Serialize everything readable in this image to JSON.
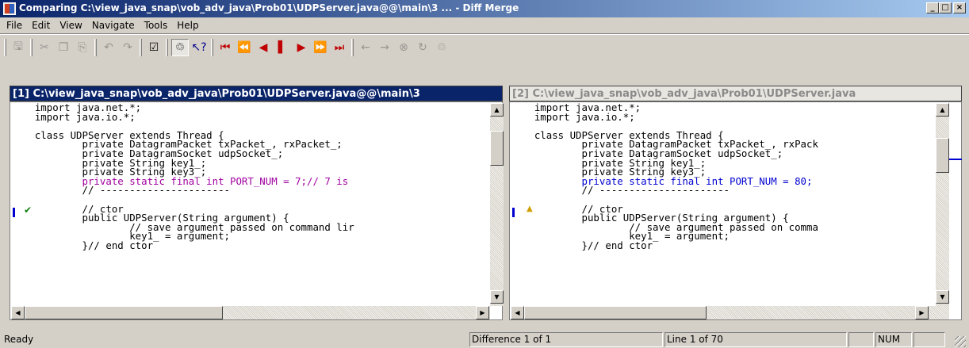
{
  "window": {
    "title": "Comparing C:\\view_java_snap\\vob_adv_java\\Prob01\\UDPServer.java@@\\main\\3 ... - Diff Merge",
    "buttons": {
      "minimize": "_",
      "maximize": "□",
      "close": "×"
    }
  },
  "menu": [
    "File",
    "Edit",
    "View",
    "Navigate",
    "Tools",
    "Help"
  ],
  "toolbar": {
    "icons": [
      "save-icon",
      "cut-icon",
      "copy-icon",
      "paste-icon",
      "undo-icon",
      "redo-icon",
      "properties-icon",
      "merge-icon",
      "help-icon",
      "first-diff-icon",
      "prev-change-icon",
      "prev-diff-icon",
      "current-diff-icon",
      "next-diff-icon",
      "next-change-icon",
      "last-diff-icon",
      "arrow-left-icon",
      "arrow-right-icon",
      "delete-icon",
      "refresh-icon",
      "merge-tool-icon"
    ]
  },
  "left_pane": {
    "header": "[1] C:\\view_java_snap\\vob_adv_java\\Prob01\\UDPServer.java@@\\main\\3",
    "lines": [
      "   import java.net.*;",
      "   import java.io.*;",
      "",
      "   class UDPServer extends Thread {",
      "           private DatagramPacket txPacket_, rxPacket_;",
      "           private DatagramSocket udpSocket_;",
      "           private String key1_;",
      "           private String key3_;",
      "           private static final int PORT_NUM = 7;// 7 is",
      "           // ----------------------",
      "",
      "           // ctor",
      "           public UDPServer(String argument) {",
      "                   // save argument passed on command lir",
      "                   key1_ = argument;",
      "           }// end ctor"
    ],
    "changed_line_index": 8,
    "marker": "✔"
  },
  "right_pane": {
    "header": "[2] C:\\view_java_snap\\vob_adv_java\\Prob01\\UDPServer.java",
    "lines": [
      "   import java.net.*;",
      "   import java.io.*;",
      "",
      "   class UDPServer extends Thread {",
      "           private DatagramPacket txPacket_, rxPack",
      "           private DatagramSocket udpSocket_;",
      "           private String key1_;",
      "           private String key3_;",
      "           private static final int PORT_NUM = 80;",
      "           // ----------------------",
      "",
      "           // ctor",
      "           public UDPServer(String argument) {",
      "                   // save argument passed on comma",
      "                   key1_ = argument;",
      "           }// end ctor"
    ],
    "changed_line_index": 8,
    "marker": "▲"
  },
  "status": {
    "ready": "Ready",
    "difference": "Difference 1 of 1",
    "line": "Line 1 of 70",
    "num": "NUM"
  },
  "colors": {
    "active_header": "#0a246a",
    "changed_left": "#a000a0",
    "changed_right": "#0000d0"
  }
}
